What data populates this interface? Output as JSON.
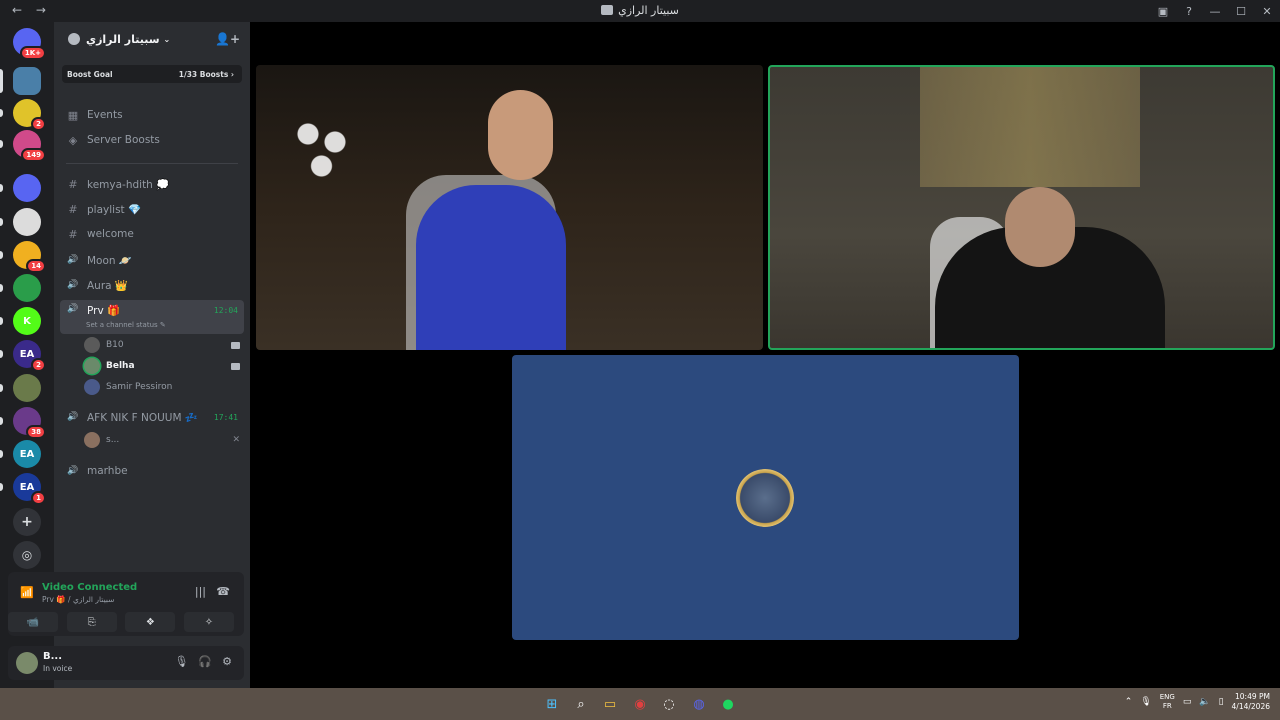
{
  "window": {
    "title": "سبيتار الرازي",
    "back_glyph": "←",
    "forward_glyph": "→",
    "controls": [
      "▣",
      "?",
      "—",
      "☐",
      "✕"
    ]
  },
  "guilds": [
    {
      "name": "discord-home",
      "label": "",
      "badge": "1K+",
      "color": "#5865f2",
      "icon": "discord-icon"
    },
    {
      "name": "server-1",
      "label": "",
      "badge": "",
      "color": "#4a7fa8"
    },
    {
      "name": "server-2",
      "label": "",
      "badge": "2",
      "color": "#e0c32a"
    },
    {
      "name": "server-3",
      "label": "",
      "badge": "149",
      "color": "#d04a8a"
    },
    {
      "name": "folder",
      "label": "",
      "badge": "",
      "color": "#5865f2"
    },
    {
      "name": "server-zven",
      "label": "",
      "badge": "",
      "color": "#dcdcdc"
    },
    {
      "name": "server-4",
      "label": "",
      "badge": "14",
      "color": "#f0b020"
    },
    {
      "name": "server-palestine",
      "label": "",
      "badge": "",
      "color": "#2a9d4a"
    },
    {
      "name": "server-kick",
      "label": "K",
      "badge": "",
      "color": "#53fc18"
    },
    {
      "name": "server-ea-1",
      "label": "EA",
      "badge": "2",
      "color": "#3a2a8a"
    },
    {
      "name": "server-5",
      "label": "",
      "badge": "",
      "color": "#6a7a4a"
    },
    {
      "name": "server-6",
      "label": "",
      "badge": "38",
      "color": "#6a3a8a"
    },
    {
      "name": "server-ea-2",
      "label": "EA",
      "badge": "",
      "color": "#1a8aa8"
    },
    {
      "name": "server-ea-3",
      "label": "EA",
      "badge": "1",
      "color": "#1a3a9a"
    }
  ],
  "server": {
    "name": "سبيتار الرازي",
    "boost_goal_label": "Boost Goal",
    "boost_count": "1/33 Boosts"
  },
  "nav_items": [
    {
      "label": "Events",
      "icon": "calendar-icon",
      "glyph": "▦"
    },
    {
      "label": "Server Boosts",
      "icon": "boost-icon",
      "glyph": "◈"
    }
  ],
  "channels": [
    {
      "label": "kemya-hdith 💭",
      "icon": "hash-icon",
      "glyph": "#"
    },
    {
      "label": "playlist 💎",
      "icon": "hash-icon",
      "glyph": "#"
    },
    {
      "label": "welcome",
      "icon": "hash-icon",
      "glyph": "#"
    },
    {
      "label": "Moon 🪐",
      "icon": "speaker-icon",
      "glyph": "🔊"
    },
    {
      "label": "Aura 👑",
      "icon": "speaker-icon",
      "glyph": "🔊"
    }
  ],
  "active_channel": {
    "label": "Prv 🎁",
    "time": "12:04",
    "status": "Set a channel status ✎"
  },
  "voice_users": [
    {
      "name": "B10",
      "color": "#5a5a5a",
      "cam": true,
      "bold": false
    },
    {
      "name": "Belha",
      "color": "#6a8a6a",
      "cam": true,
      "bold": true
    },
    {
      "name": "Samir Pessiron",
      "color": "#4a5a8a",
      "cam": false,
      "bold": false
    }
  ],
  "afk_channel": {
    "label": "AFK NIK F NOUUM 💤",
    "time": "17:41",
    "user": "s...",
    "muted_glyph": "✕"
  },
  "last_channel": {
    "label": "marhbe"
  },
  "voice_panel": {
    "status": "Video Connected",
    "subtitle": "Prv 🎁 / سبيتار الرازي",
    "buttons": [
      "📹",
      "⎘",
      "❖",
      "✧"
    ]
  },
  "user": {
    "name": "B...",
    "status": "In voice"
  },
  "taskbar": {
    "lang_top": "ENG",
    "lang_bottom": "FR",
    "time": "10:49 PM",
    "date": "4/14/2026"
  }
}
